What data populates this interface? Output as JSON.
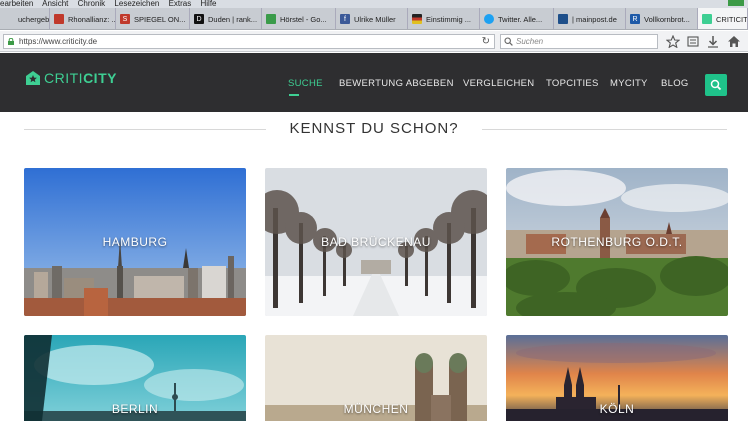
{
  "menubar": {
    "items": [
      "earbeiten",
      "Ansicht",
      "Chronik",
      "Lesezeichen",
      "Extras",
      "Hilfe"
    ]
  },
  "tabs": [
    {
      "label": "uchergebni...",
      "icon": "generic-icon",
      "color": "#999999"
    },
    {
      "label": "Rhonallianz: ...",
      "icon": "news-icon",
      "color": "#c0392b"
    },
    {
      "label": "SPIEGEL ON...",
      "icon": "spiegel-icon",
      "color": "#c0392b"
    },
    {
      "label": "Duden | rank...",
      "icon": "duden-icon",
      "color": "#111111"
    },
    {
      "label": "Hörstel - Go...",
      "icon": "maps-icon",
      "color": "#3a9b4a"
    },
    {
      "label": "Ulrike Müller",
      "icon": "facebook-icon",
      "color": "#3b5998"
    },
    {
      "label": "Einstimmig ...",
      "icon": "flag-icon",
      "color": "#e0a020"
    },
    {
      "label": "Twitter. Alle...",
      "icon": "twitter-icon",
      "color": "#1da1f2"
    },
    {
      "label": "| mainpost.de",
      "icon": "mainpost-icon",
      "color": "#1e4f8a"
    },
    {
      "label": "Vollkornbrot...",
      "icon": "br-icon",
      "color": "#1e5aa8"
    },
    {
      "label": "CRITICIT...",
      "icon": "criticity-icon",
      "color": "#3ecf93"
    }
  ],
  "address": {
    "url": "https://www.criticity.de",
    "search_placeholder": "Suchen"
  },
  "site": {
    "logo_light": "CRITI",
    "logo_bold": "CITY",
    "nav": [
      "SUCHE",
      "BEWERTUNG ABGEBEN",
      "VERGLEICHEN",
      "TOPCITIES",
      "MYCITY",
      "BLOG"
    ],
    "accent": "#3ecf93"
  },
  "section": {
    "title": "KENNST DU SCHON?"
  },
  "cities": [
    {
      "name": "HAMBURG"
    },
    {
      "name": "BAD BRÜCKENAU"
    },
    {
      "name": "ROTHENBURG O.D.T."
    },
    {
      "name": "BERLIN"
    },
    {
      "name": "MÜNCHEN"
    },
    {
      "name": "KÖLN"
    }
  ]
}
